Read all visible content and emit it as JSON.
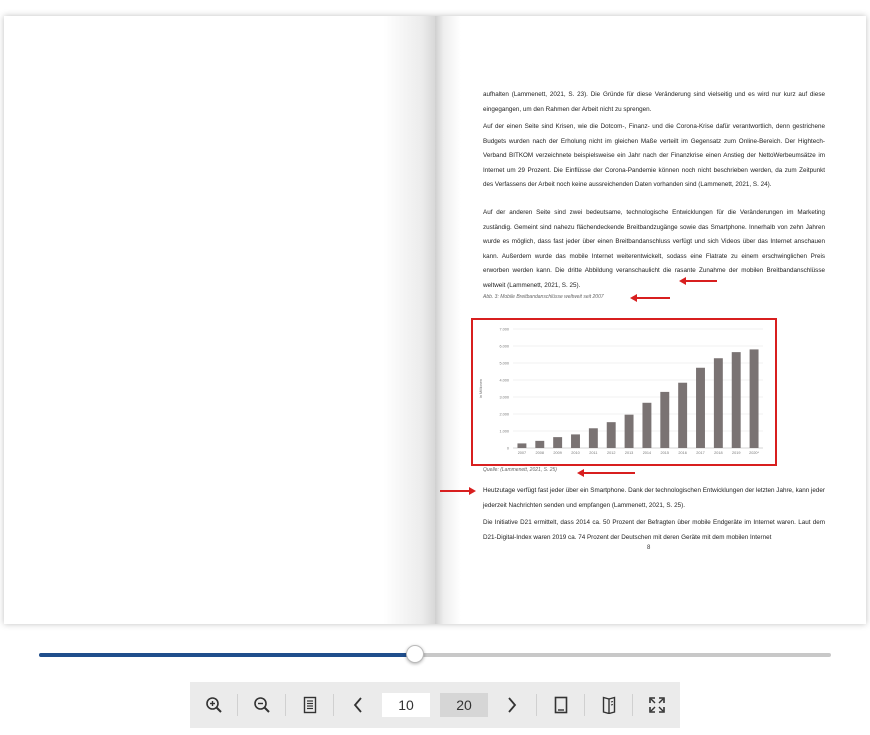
{
  "page": {
    "paragraphs": [
      "aufhalten (Lammenett, 2021, S. 23). Die Gründe für diese Veränderung sind vielseitig und es wird nur kurz auf diese eingegangen, um den Rahmen der Arbeit nicht zu sprengen.",
      "Auf der einen Seite sind Krisen, wie die Dotcom-, Finanz- und die Corona-Krise dafür verantwortlich, denn gestrichene Budgets wurden nach der Erholung nicht im gleichen Maße verteilt im Gegensatz zum Online-Bereich. Der Hightech-Verband BITKOM verzeichnete beispielsweise ein Jahr nach der Finanzkrise einen Anstieg der NettoWerbeumsätze im Internet um 29 Prozent. Die Einflüsse der Corona-Pandemie können noch nicht beschrieben werden, da zum Zeitpunkt des Verfassens der Arbeit noch keine aussreichenden Daten vorhanden sind (Lammenett, 2021, S. 24).",
      "Auf der anderen Seite sind zwei bedeutsame, technologische Entwicklungen für die Veränderungen im Marketing zuständig. Gemeint sind nahezu flächendeckende Breitbandzugänge sowie das Smartphone. Innerhalb von zehn Jahren wurde es möglich, dass fast jeder über einen Breitbandanschluss verfügt und sich Videos über das Internet anschauen kann. Außerdem wurde das mobile Internet weiterentwickelt, sodass eine Flatrate zu einem erschwinglichen Preis erworben werden kann. Die dritte Abbildung veranschaulicht die rasante Zunahme der mobilen Breitbandanschlüsse weltweit (Lammenett, 2021, S. 25).",
      "Heutzutage verfügt fast jeder über ein Smartphone. Dank der technologischen Entwicklungen der letzten Jahre, kann jeder jederzeit Nachrichten senden und empfangen (Lammenett, 2021, S. 25).",
      "Die Initiative D21 ermittelt, dass 2014 ca. 50 Prozent der Befragten über mobile Endgeräte im Internet waren. Laut dem D21-Digital-Index waren 2019 ca. 74 Prozent der Deutschen mit deren Geräte mit dem mobilen Internet"
    ],
    "figure_caption": "Abb. 3: Mobile Breitbandanschlüsse weltweit seit 2007",
    "source_caption": "Quelle: (Lammenett, 2021, S. 25)",
    "page_number": "8"
  },
  "chart_data": {
    "type": "bar",
    "ylabel": "in Millionen",
    "ylim": [
      0,
      7000
    ],
    "yticks": [
      "0",
      "1.000",
      "2.000",
      "3.000",
      "4.000",
      "5.000",
      "6.000",
      "7.000"
    ],
    "categories": [
      "2007",
      "2008",
      "2009",
      "2010",
      "2011",
      "2012",
      "2013",
      "2014",
      "2015",
      "2016",
      "2017",
      "2018",
      "2019",
      "2020*"
    ],
    "values": [
      270,
      420,
      640,
      800,
      1160,
      1520,
      1960,
      2660,
      3300,
      3840,
      4720,
      5280,
      5640,
      5800
    ],
    "bar_color": "#7a7373",
    "grid": true
  },
  "slider": {
    "progress": 0.475
  },
  "toolbar": {
    "current_page": "10",
    "total_pages": "20",
    "icons": [
      "zoom-in-icon",
      "zoom-out-icon",
      "document-icon",
      "chevron-left-icon",
      "chevron-right-icon",
      "single-page-icon",
      "double-page-icon",
      "fullscreen-icon"
    ]
  },
  "colors": {
    "accent": "#1f4e8c",
    "highlight": "#d81f1f",
    "toolbar_bg": "#ebebeb"
  }
}
